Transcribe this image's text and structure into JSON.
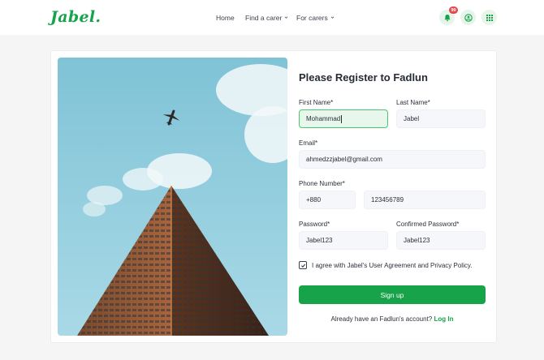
{
  "header": {
    "logo": "Jabel.",
    "nav": {
      "home": "Home",
      "find_carer": "Find a carer",
      "for_carers": "For carers"
    },
    "notification_count": "99",
    "icons": [
      "bell-icon",
      "user-circle-icon",
      "grid-icon"
    ]
  },
  "form": {
    "title": "Please Register to Fadlun",
    "first_name_label": "First Name*",
    "first_name_value": "Mohammad",
    "last_name_label": "Last Name*",
    "last_name_value": "Jabel",
    "email_label": "Email*",
    "email_value": "ahmedzzjabel@gmail.com",
    "phone_label": "Phone Number*",
    "phone_code_value": "+880",
    "phone_value": "123456789",
    "password_label": "Password*",
    "password_value": "Jabel123",
    "confirm_label": "Confirmed Password*",
    "confirm_value": "Jabel123",
    "agree_text": "I agree with Jabel's User Agreement and Privacy Policy.",
    "agree_checked": true,
    "signup_label": "Sign up",
    "login_prompt": "Already have an Fadlun's account?",
    "login_link": "Log In"
  },
  "colors": {
    "brand": "#16a34a",
    "active_field_bg": "#e8f7ec",
    "badge": "#e5484d"
  }
}
